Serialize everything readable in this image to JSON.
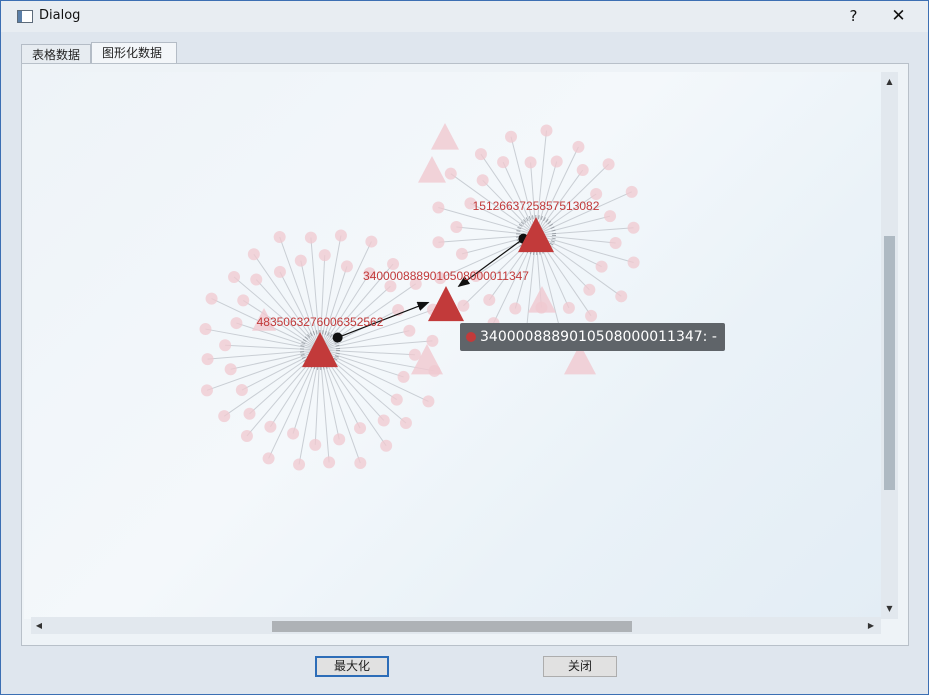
{
  "window": {
    "title": "Dialog",
    "help_label": "?",
    "close_label": "✕"
  },
  "tabs": [
    {
      "label": "表格数据",
      "selected": false
    },
    {
      "label": "图形化数据",
      "selected": true
    }
  ],
  "graph": {
    "nodes": [
      {
        "id": "4835063276006352562",
        "role": "hub"
      },
      {
        "id": "3400008889010508000011347",
        "role": "hub"
      },
      {
        "id": "1512663725857513082",
        "role": "hub"
      }
    ],
    "edges": [
      {
        "from": "4835063276006352562",
        "to": "3400008889010508000011347"
      },
      {
        "from": "1512663725857513082",
        "to": "3400008889010508000011347"
      }
    ],
    "colors": {
      "node": "#c23a3a",
      "faded": "#f0c8cf",
      "edge": "#111111"
    }
  },
  "tooltip": {
    "text": "3400008889010508000011347: -"
  },
  "scroll": {
    "up": "▲",
    "down": "▼",
    "left": "◀",
    "right": "▶"
  },
  "buttons": {
    "maximize": "最大化",
    "close": "关闭"
  }
}
